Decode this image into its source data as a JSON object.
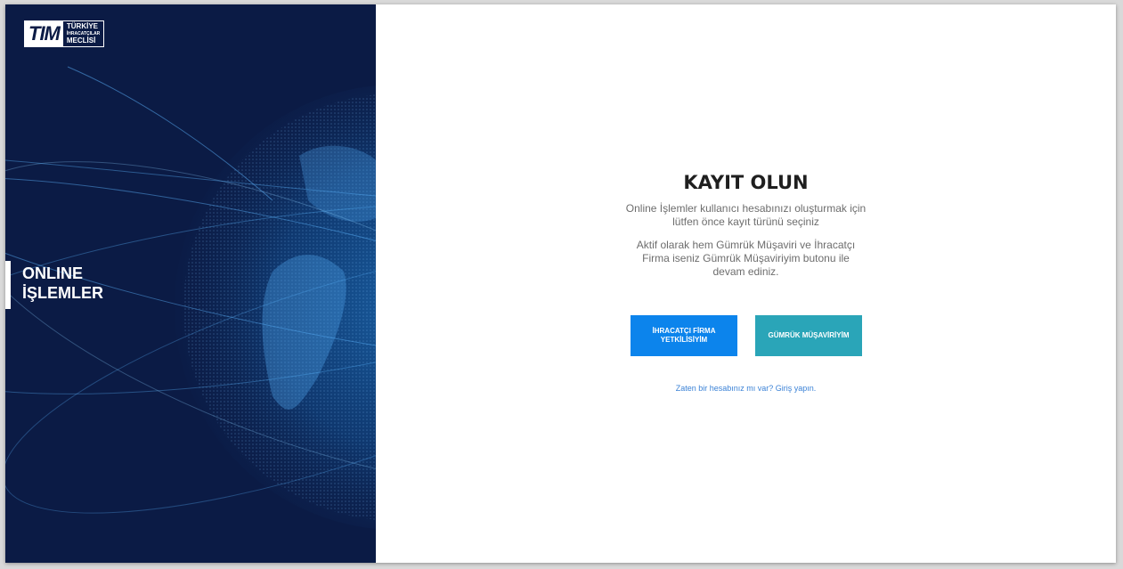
{
  "left": {
    "logo": {
      "mark": "TIM",
      "line1": "TÜRKİYE",
      "line2": "İHRACATÇILAR",
      "line3": "MECLİSİ"
    },
    "title_line1": "ONLINE",
    "title_line2": "İŞLEMLER"
  },
  "register": {
    "title": "KAYIT OLUN",
    "intro": "Online İşlemler kullanıcı hesabınızı oluşturmak için lütfen önce kayıt türünü seçiniz",
    "note": "Aktif olarak hem Gümrük Müşaviri ve İhracatçı Firma iseniz Gümrük Müşaviriyim butonu ile devam ediniz.",
    "exporter_button": "İHRACATÇI FİRMA YETKİLİSİYİM",
    "customs_button": "GÜMRÜK MÜŞAVİRİYİM",
    "login_link": "Zaten bir hesabınız mı var? Giriş yapın."
  },
  "colors": {
    "panel": "#0b1b45",
    "exporter_button": "#0c84ec",
    "customs_button": "#2aa5b8",
    "link": "#3b82d6"
  }
}
